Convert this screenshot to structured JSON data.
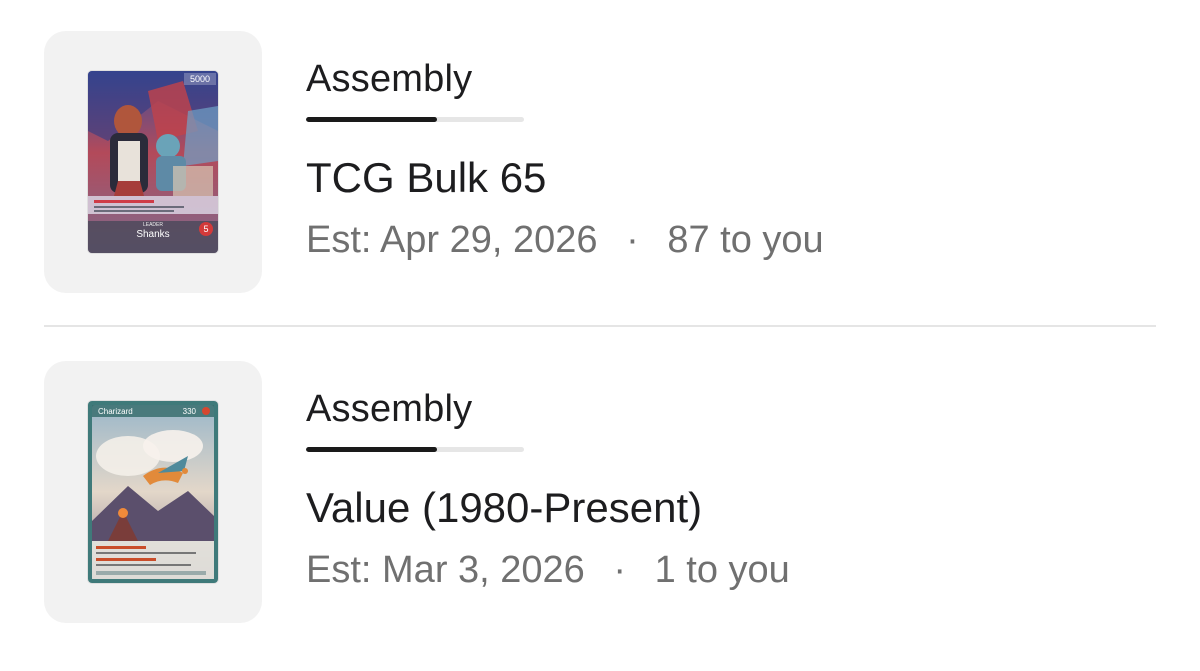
{
  "orders": [
    {
      "status": "Assembly",
      "progress": 0.6,
      "title": "TCG Bulk 65",
      "est_label": "Est:",
      "est_date": "Apr 29, 2026",
      "separator": "·",
      "recipient": "87 to you",
      "card": {
        "hp": "5000",
        "leader_label": "LEADER",
        "name": "Shanks",
        "life": "5"
      }
    },
    {
      "status": "Assembly",
      "progress": 0.6,
      "title": "Value (1980-Present)",
      "est_label": "Est:",
      "est_date": "Mar 3, 2026",
      "separator": "·",
      "recipient": "1 to you",
      "card": {
        "name": "Charizard",
        "hp": "330"
      }
    }
  ],
  "colors": {
    "text_primary": "#1d1d1f",
    "text_secondary": "#707070",
    "progress_fill": "#1a1a1a",
    "progress_track": "#e6e6e6",
    "thumb_bg": "#f2f2f2"
  }
}
